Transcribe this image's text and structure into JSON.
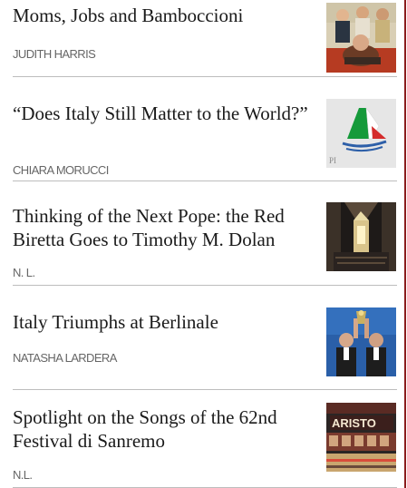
{
  "articles": [
    {
      "title": "Moms, Jobs and Bamboccioni",
      "author": "JUDITH HARRIS",
      "thumb_icon": "family-photo-thumbnail"
    },
    {
      "title": "“Does Italy Still Matter to the World?”",
      "author": "CHIARA MORUCCI",
      "thumb_icon": "italian-flag-sail-logo-thumbnail"
    },
    {
      "title": "Thinking of the Next Pope: the Red Biretta Goes to Timothy M. Dolan",
      "author": "N. L.",
      "thumb_icon": "cathedral-interior-thumbnail"
    },
    {
      "title": "Italy Triumphs at Berlinale",
      "author": "NATASHA LARDERA",
      "thumb_icon": "award-winners-thumbnail"
    },
    {
      "title": "Spotlight on the Songs of the 62nd Festival di Sanremo",
      "author": "N.L.",
      "thumb_icon": "ariston-theatre-thumbnail"
    }
  ],
  "thumb_logo_text": "PI",
  "ariston_sign": "ARISTO",
  "colors": {
    "divider": "#bdbdbd",
    "accent_line": "#8a1c1c",
    "title": "#1a1a1a",
    "author": "#666666"
  }
}
